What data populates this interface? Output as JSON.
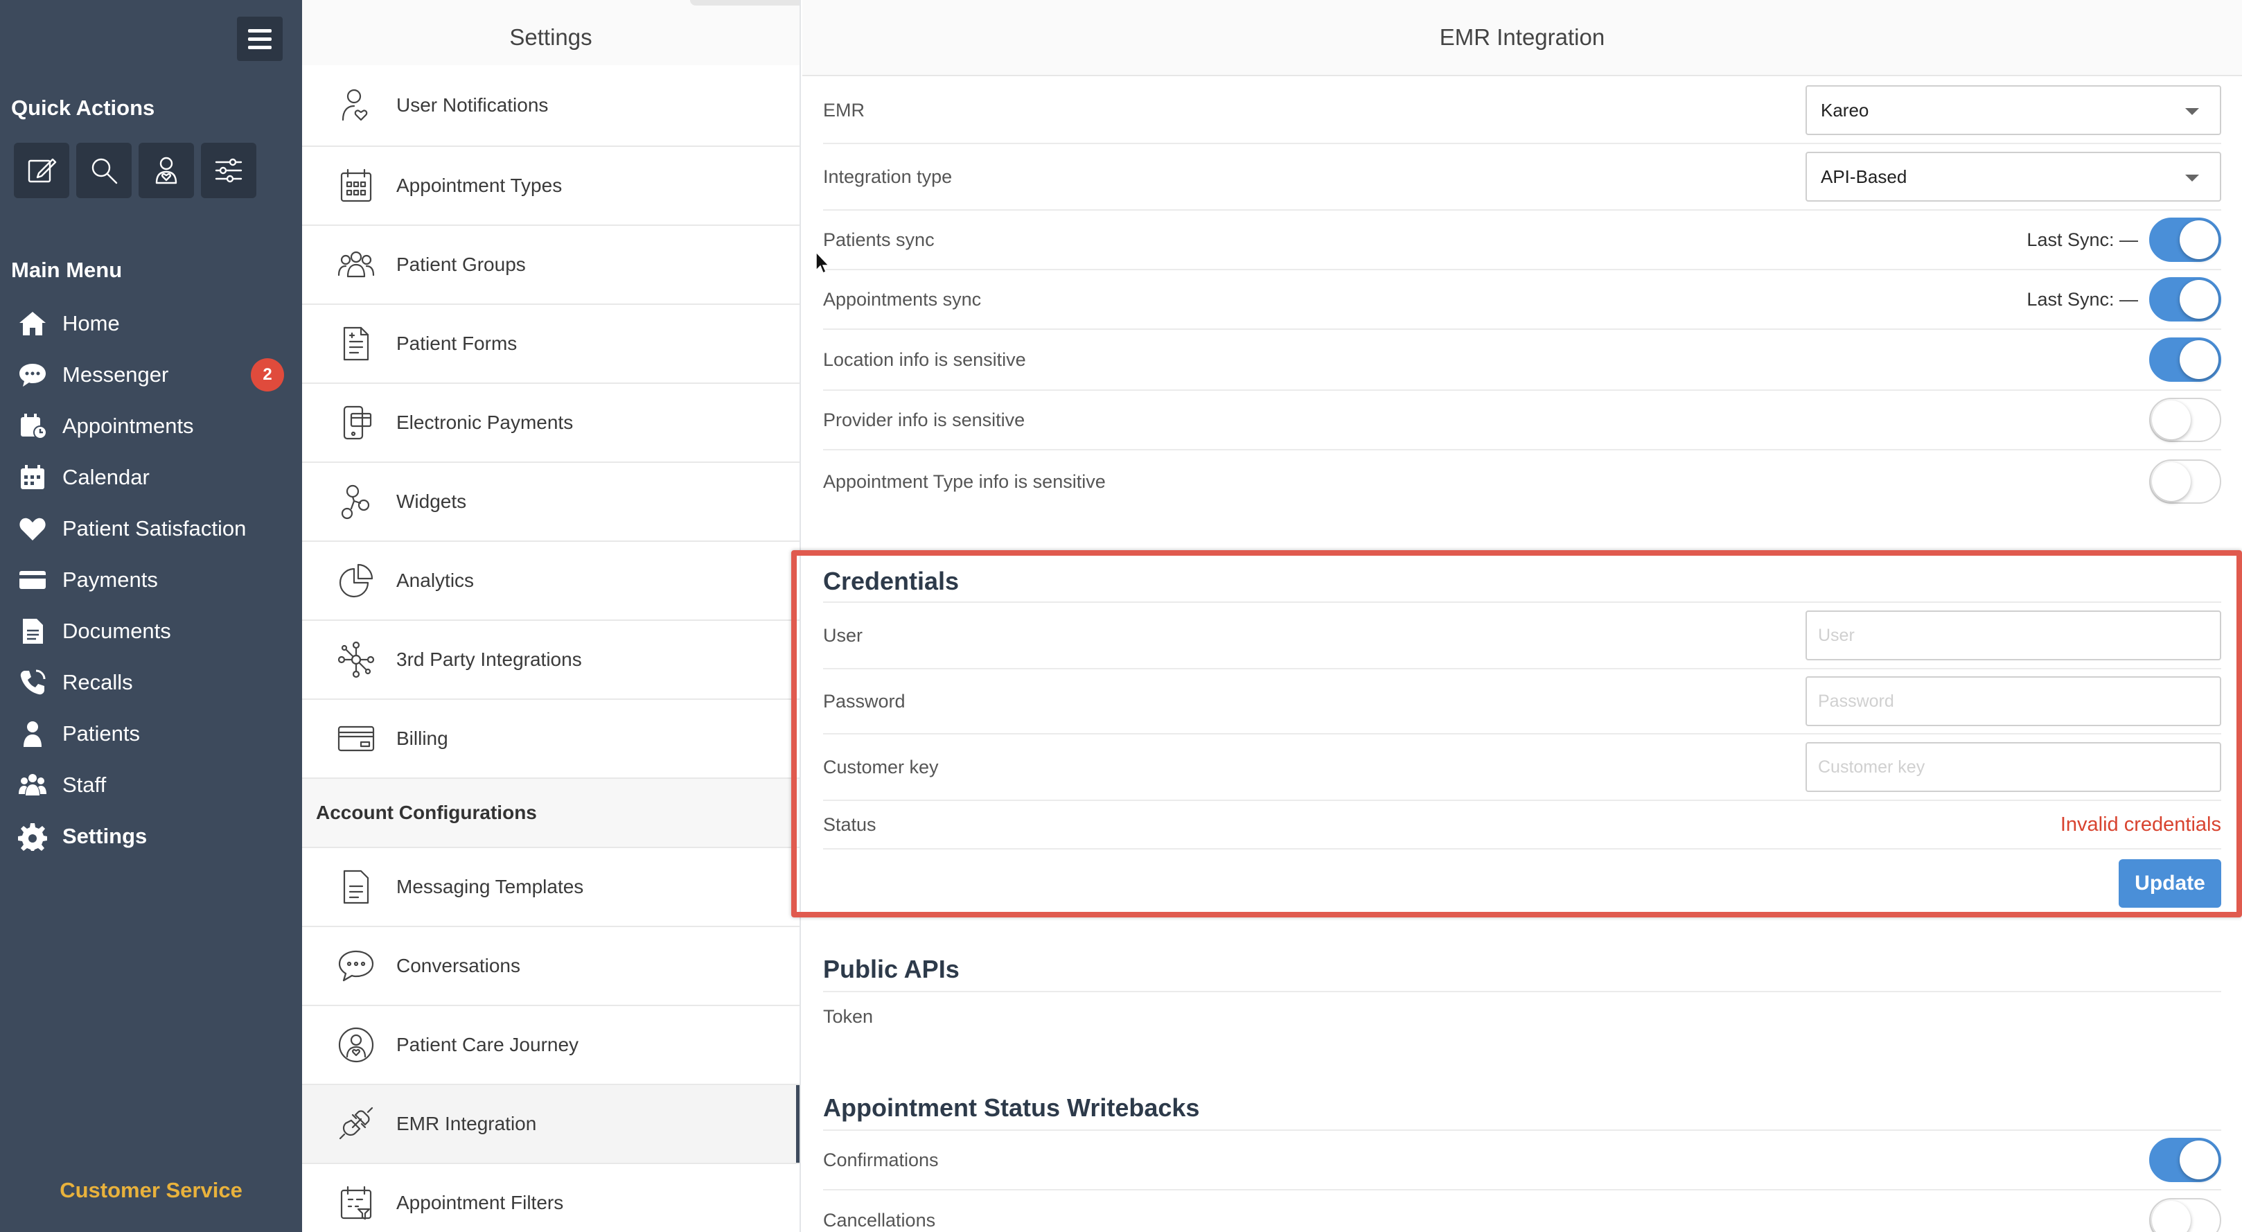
{
  "sidebar": {
    "quick_actions_title": "Quick Actions",
    "main_menu_title": "Main Menu",
    "quick_actions": [
      {
        "icon": "compose-icon"
      },
      {
        "icon": "search-icon"
      },
      {
        "icon": "user-heart-icon"
      },
      {
        "icon": "sliders-icon"
      }
    ],
    "menu": [
      {
        "label": "Home",
        "icon": "home-icon"
      },
      {
        "label": "Messenger",
        "icon": "chat-icon",
        "badge": "2"
      },
      {
        "label": "Appointments",
        "icon": "appointments-icon"
      },
      {
        "label": "Calendar",
        "icon": "calendar-icon"
      },
      {
        "label": "Patient Satisfaction",
        "icon": "heart-icon"
      },
      {
        "label": "Payments",
        "icon": "card-icon"
      },
      {
        "label": "Documents",
        "icon": "document-icon"
      },
      {
        "label": "Recalls",
        "icon": "phone-icon"
      },
      {
        "label": "Patients",
        "icon": "patient-icon"
      },
      {
        "label": "Staff",
        "icon": "staff-icon"
      },
      {
        "label": "Settings",
        "icon": "gear-icon",
        "active": true
      }
    ],
    "customer_service": "Customer Service"
  },
  "settings": {
    "title": "Settings",
    "items": [
      {
        "label": "User Notifications",
        "icon": "user-notification-icon"
      },
      {
        "label": "Appointment Types",
        "icon": "calendar-grid-icon"
      },
      {
        "label": "Patient Groups",
        "icon": "group-icon"
      },
      {
        "label": "Patient Forms",
        "icon": "form-icon"
      },
      {
        "label": "Electronic Payments",
        "icon": "payment-device-icon"
      },
      {
        "label": "Widgets",
        "icon": "widget-icon"
      },
      {
        "label": "Analytics",
        "icon": "pie-chart-icon"
      },
      {
        "label": "3rd Party Integrations",
        "icon": "network-icon"
      },
      {
        "label": "Billing",
        "icon": "billing-card-icon"
      }
    ],
    "account_group": "Account Configurations",
    "account_items": [
      {
        "label": "Messaging Templates",
        "icon": "template-icon"
      },
      {
        "label": "Conversations",
        "icon": "conversation-icon"
      },
      {
        "label": "Patient Care Journey",
        "icon": "care-journey-icon"
      },
      {
        "label": "EMR Integration",
        "icon": "plug-icon",
        "active": true
      },
      {
        "label": "Appointment Filters",
        "icon": "filter-calendar-icon"
      }
    ]
  },
  "emr": {
    "title": "EMR Integration",
    "emr_label": "EMR",
    "emr_value": "Kareo",
    "integration_label": "Integration type",
    "integration_value": "API-Based",
    "patients_sync_label": "Patients sync",
    "patients_last_sync": "Last Sync: —",
    "appointments_sync_label": "Appointments sync",
    "appointments_last_sync": "Last Sync: —",
    "location_label": "Location info is sensitive",
    "provider_label": "Provider info is sensitive",
    "appt_type_label": "Appointment Type info is sensitive",
    "toggles": {
      "patients_sync": true,
      "appointments_sync": true,
      "location": true,
      "provider": false,
      "appt_type": false,
      "confirmations": true,
      "cancellations": false
    },
    "credentials": {
      "title": "Credentials",
      "user_label": "User",
      "user_placeholder": "User",
      "password_label": "Password",
      "password_placeholder": "Password",
      "key_label": "Customer key",
      "key_placeholder": "Customer key",
      "status_label": "Status",
      "status_value": "Invalid credentials",
      "update_button": "Update"
    },
    "public_apis": {
      "title": "Public APIs",
      "token_label": "Token"
    },
    "writebacks": {
      "title": "Appointment Status Writebacks",
      "confirmations_label": "Confirmations",
      "cancellations_label": "Cancellations"
    }
  },
  "colors": {
    "sidebar_bg": "#3d4a5c",
    "accent_blue": "#4a8fd8",
    "highlight_red": "#e05a4e",
    "status_red": "#d8432f",
    "customer_service": "#e9b23c"
  }
}
